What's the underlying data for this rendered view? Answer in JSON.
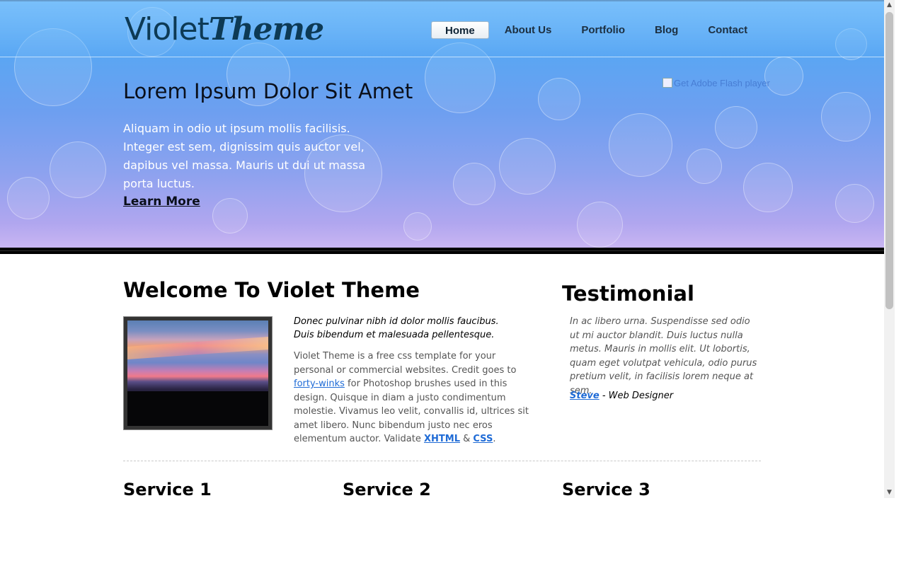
{
  "header": {
    "logo_light": "Violet",
    "logo_bold": "Theme",
    "nav": [
      {
        "label": "Home",
        "active": true
      },
      {
        "label": "About Us"
      },
      {
        "label": "Portfolio"
      },
      {
        "label": "Blog"
      },
      {
        "label": "Contact"
      }
    ]
  },
  "hero": {
    "title": "Lorem Ipsum Dolor Sit Amet",
    "text": "Aliquam in odio ut ipsum mollis facilisis. Integer est sem, dignissim quis auctor vel, dapibus vel massa. Mauris ut dui ut massa porta luctus.",
    "link": "Learn More",
    "flash_alt": "Get Adobe Flash player"
  },
  "welcome": {
    "title": "Welcome To Violet Theme",
    "lead": "Donec pulvinar nibh id dolor mollis faucibus. Duis bibendum et malesuada pellentesque.",
    "body_1": "Violet Theme is a free css template for your personal or commercial websites. Credit goes to ",
    "link_fortywinks": "forty-winks",
    "body_2": " for Photoshop brushes used in this design. Quisque in diam a justo condimentum molestie. Vivamus leo velit, convallis id, ultrices sit amet libero. Nunc bibendum justo nec eros elementum auctor. Validate ",
    "link_xhtml": "XHTML",
    "amp": " & ",
    "link_css": "CSS",
    "period": "."
  },
  "testimonial": {
    "title": "Testimonial",
    "text": "In ac libero urna. Suspendisse sed odio ut mi auctor blandit. Duis luctus nulla metus. Mauris in mollis elit. Ut lobortis, quam eget volutpat vehicula, odio purus pretium velit, in facilisis lorem neque at sem.",
    "author_name": "Steve",
    "author_role": " - Web Designer"
  },
  "services": [
    {
      "title": "Service 1"
    },
    {
      "title": "Service 2"
    },
    {
      "title": "Service 3"
    }
  ],
  "icons": {
    "scroll_up": "scroll-up-arrow-icon",
    "scroll_down": "scroll-down-arrow-icon",
    "broken_image": "broken-image-icon"
  }
}
